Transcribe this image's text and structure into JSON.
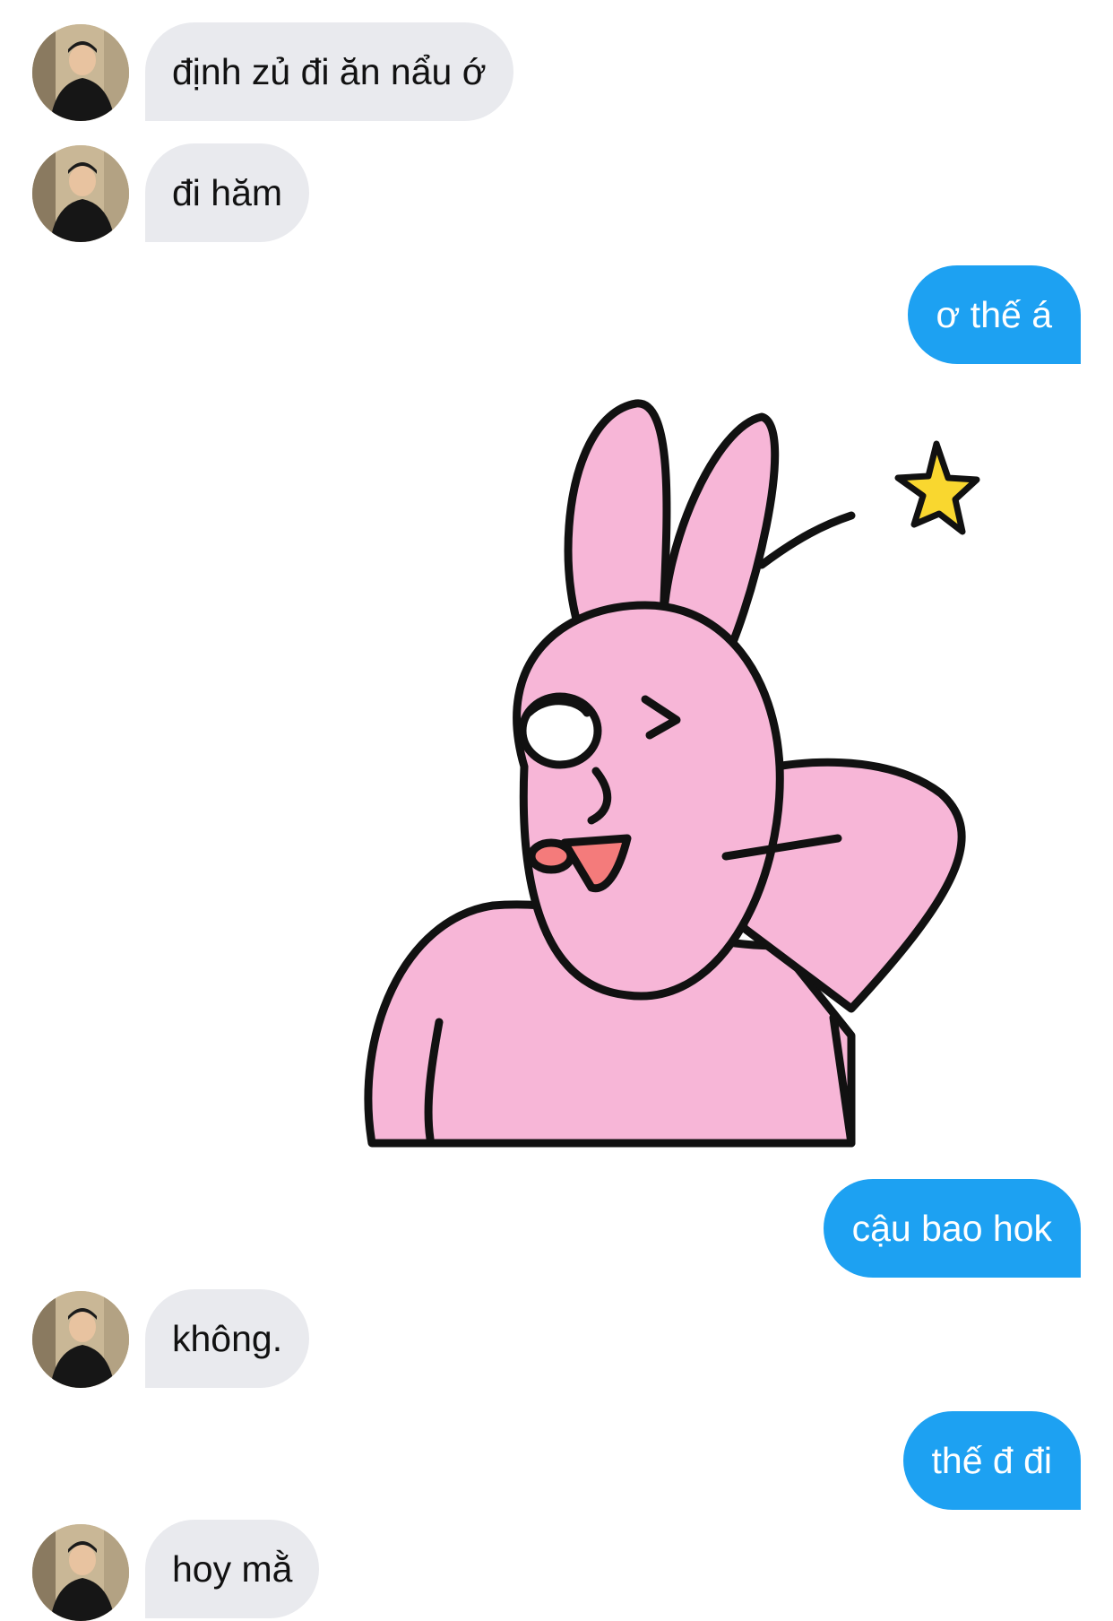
{
  "chat": {
    "messages": [
      {
        "sender": "contact",
        "text": "định zủ đi ăn nẩu ớ"
      },
      {
        "sender": "contact",
        "text": "đi hăm"
      },
      {
        "sender": "me",
        "text": "ơ thế á"
      },
      {
        "sender": "me",
        "type": "sticker",
        "sticker": "pink-bunny-wink-sticker"
      },
      {
        "sender": "me",
        "text": "cậu bao hok"
      },
      {
        "sender": "contact",
        "text": "không."
      },
      {
        "sender": "me",
        "text": "thế đ đi"
      },
      {
        "sender": "contact",
        "text": "hoy mằ"
      }
    ]
  },
  "colors": {
    "incoming_bubble": "#e9eaee",
    "outgoing_bubble": "#1da1f2",
    "outgoing_text": "#ffffff",
    "sticker_pink": "#f7b6d7"
  }
}
